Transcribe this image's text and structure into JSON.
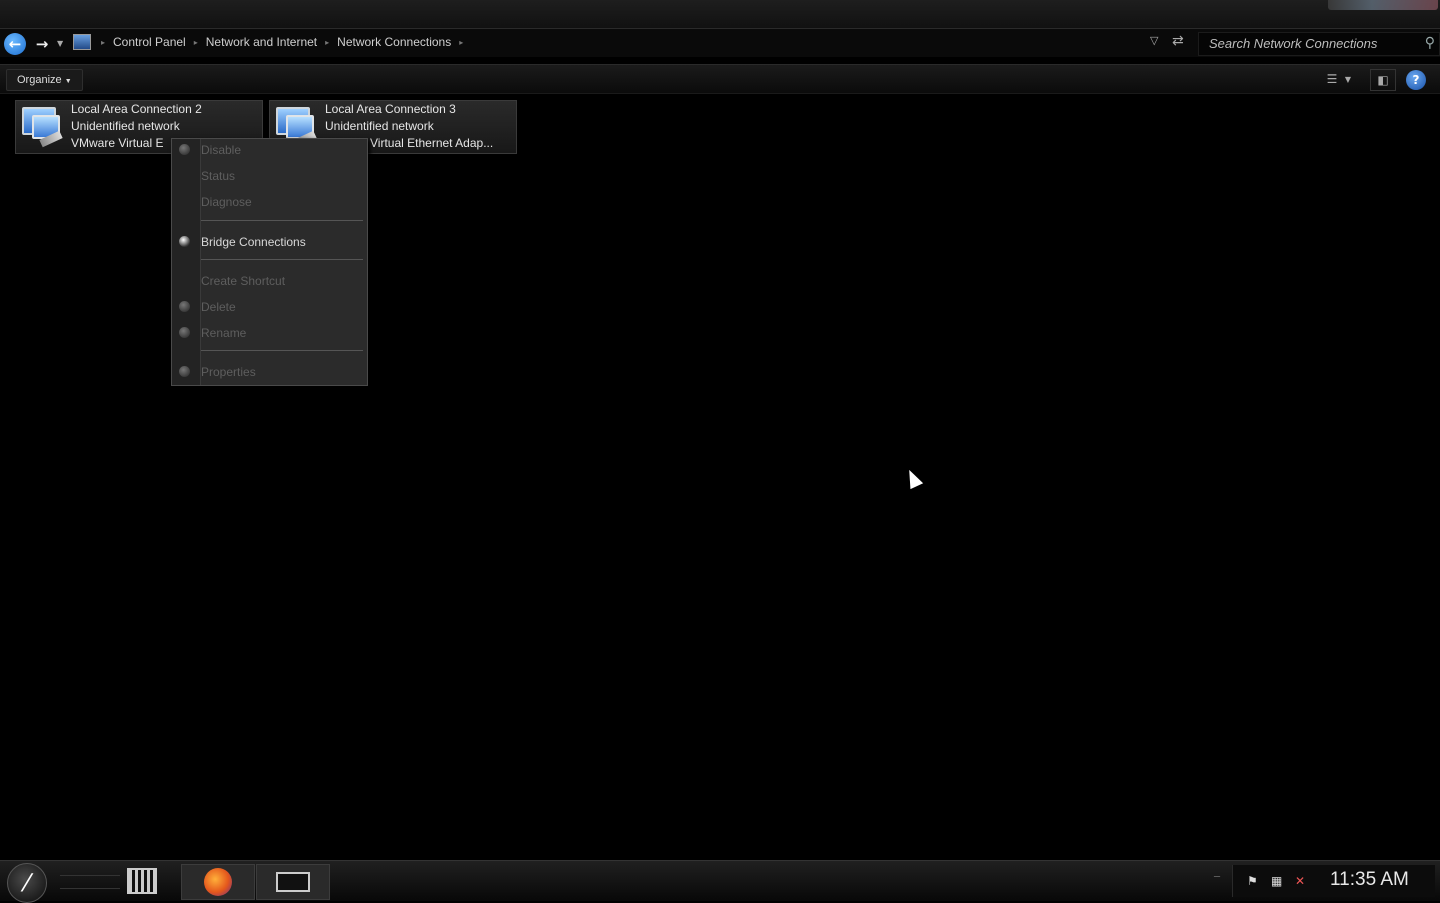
{
  "address_bar": {
    "breadcrumbs": [
      "Control Panel",
      "Network and Internet",
      "Network Connections"
    ],
    "search_placeholder": "Search Network Connections"
  },
  "toolbar": {
    "organize_label": "Organize"
  },
  "connections": [
    {
      "name": "Local Area Connection 2",
      "status": "Unidentified network",
      "adapter": "VMware Virtual E"
    },
    {
      "name": "Local Area Connection 3",
      "status": "Unidentified network",
      "adapter": "e Virtual Ethernet Adap..."
    }
  ],
  "context_menu": {
    "items": [
      {
        "label": "Disable",
        "enabled": false
      },
      {
        "label": "Status",
        "enabled": false
      },
      {
        "label": "Diagnose",
        "enabled": false
      },
      {
        "label": "Bridge Connections",
        "enabled": true
      },
      {
        "label": "Create Shortcut",
        "enabled": false
      },
      {
        "label": "Delete",
        "enabled": false
      },
      {
        "label": "Rename",
        "enabled": false
      },
      {
        "label": "Properties",
        "enabled": false
      }
    ]
  },
  "taskbar": {
    "apps": [
      "film-icon",
      "firefox-icon",
      "network-adapter-icon"
    ],
    "tray_icons": [
      "flag-icon",
      "network-icon",
      "volume-muted-icon"
    ],
    "clock": "11:35 AM"
  }
}
